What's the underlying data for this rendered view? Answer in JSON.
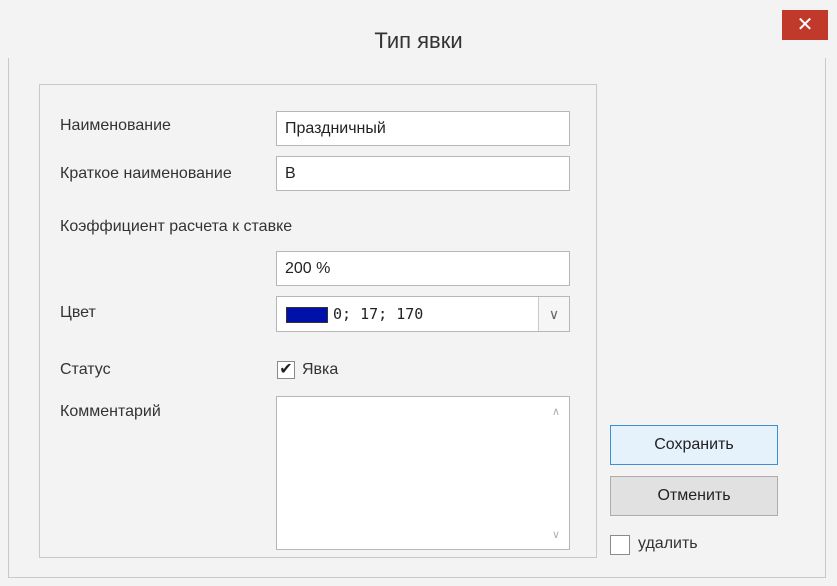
{
  "dialog": {
    "title": "Тип явки",
    "close_icon": "✕"
  },
  "form": {
    "name_label": "Наименование",
    "name_value": "Праздничный",
    "short_name_label": "Краткое наименование",
    "short_name_value": "В",
    "rate_label": "Коэффициент расчета к ставке",
    "rate_value": "200 %",
    "color_label": "Цвет",
    "color_value": "0; 17; 170",
    "color_hex": "#0011aa",
    "status_label": "Статус",
    "status_checkbox_label": "Явка",
    "status_checked": true,
    "comment_label": "Комментарий",
    "comment_value": ""
  },
  "actions": {
    "save_label": "Сохранить",
    "cancel_label": "Отменить",
    "delete_label": "удалить",
    "delete_checked": false
  }
}
